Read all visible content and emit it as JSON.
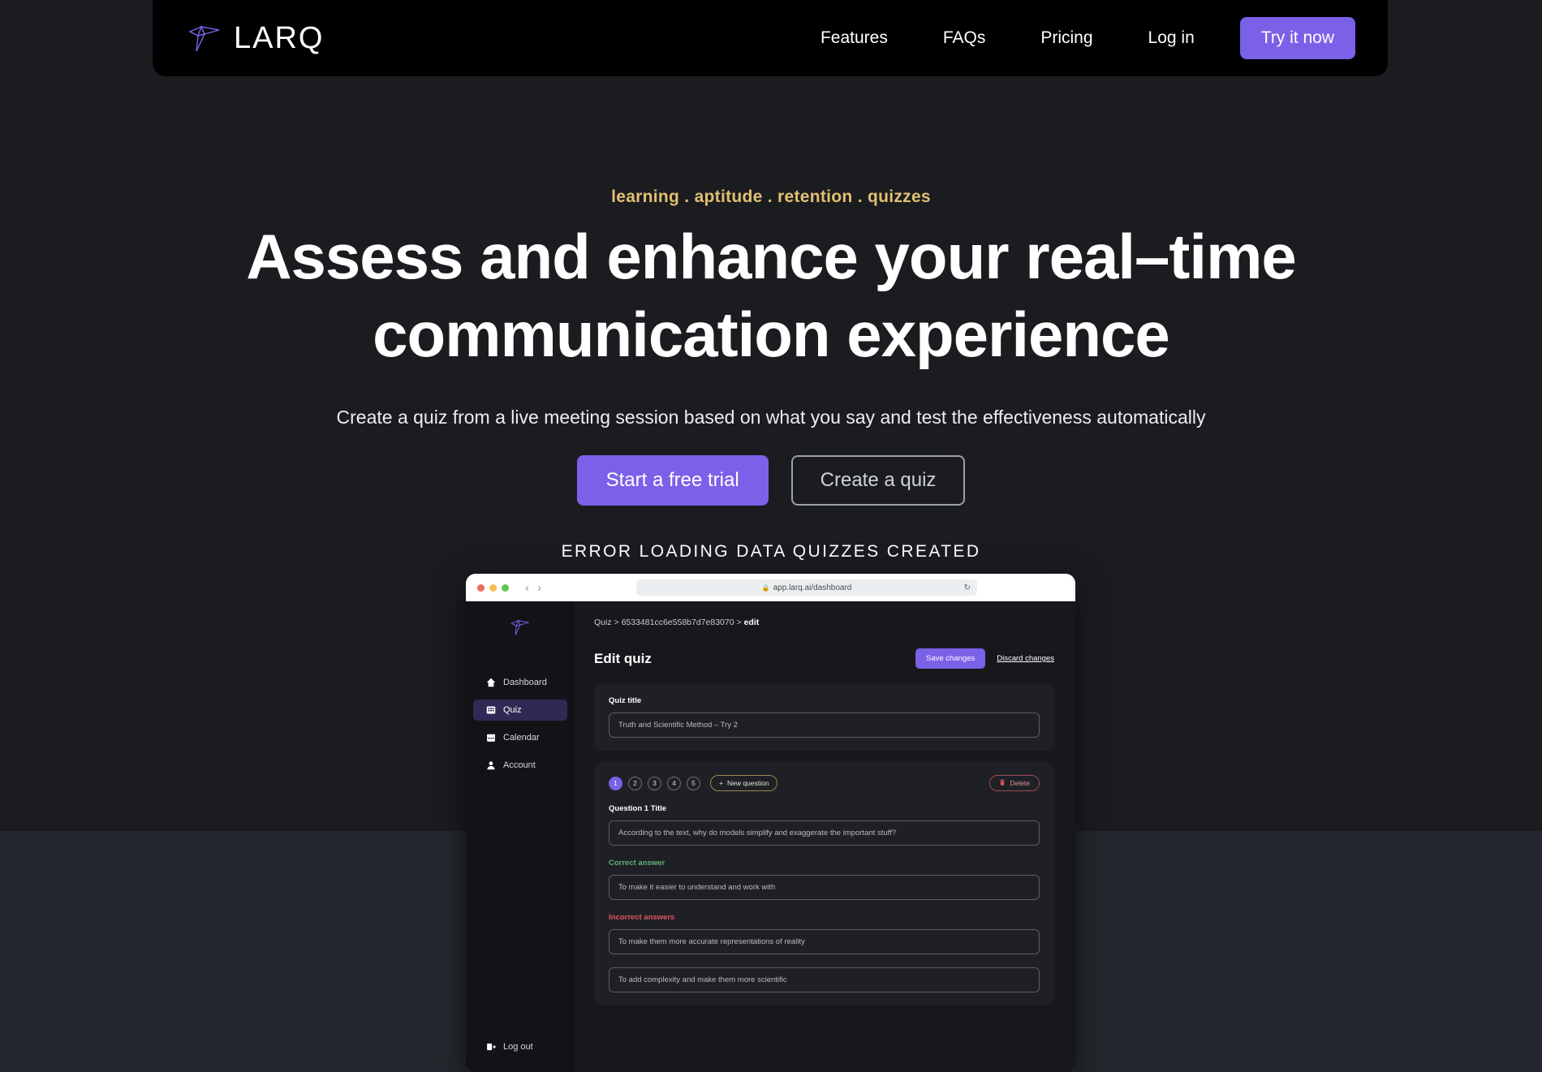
{
  "nav": {
    "brand_name": "LARQ",
    "brand_logo_icon": "hummingbird-logo-icon",
    "links": [
      {
        "label": "Features"
      },
      {
        "label": "FAQs"
      },
      {
        "label": "Pricing"
      },
      {
        "label": "Log in"
      }
    ],
    "cta_label": "Try it now"
  },
  "hero": {
    "eyebrow": "learning . aptitude . retention . quizzes",
    "headline_line1": "Assess and enhance your real–time",
    "headline_line2": "communication experience",
    "subtitle": "Create a quiz from a live meeting session based on what you say and test the effectiveness automatically",
    "primary_cta": "Start a free trial",
    "secondary_cta": "Create a quiz",
    "stat_line": "ERROR LOADING DATA QUIZZES CREATED"
  },
  "mockup": {
    "browser": {
      "url": "app.larq.ai/dashboard",
      "lock_icon": "lock-icon",
      "back_icon": "chevron-left-icon",
      "forward_icon": "chevron-right-icon",
      "reload_icon": "reload-icon"
    },
    "sidebar": {
      "logo_icon": "hummingbird-logo-icon",
      "items": [
        {
          "label": "Dashboard",
          "icon": "home-icon",
          "active": false
        },
        {
          "label": "Quiz",
          "icon": "grid-icon",
          "active": true
        },
        {
          "label": "Calendar",
          "icon": "calendar-icon",
          "active": false
        },
        {
          "label": "Account",
          "icon": "user-icon",
          "active": false
        }
      ],
      "logout": {
        "label": "Log out",
        "icon": "logout-icon"
      }
    },
    "breadcrumb": {
      "root": "Quiz",
      "sep1": ">",
      "id": "6533481cc6e558b7d7e83070",
      "sep2": ">",
      "current": "edit"
    },
    "page_title": "Edit quiz",
    "save_label": "Save changes",
    "discard_label": "Discard changes",
    "quiz_title_label": "Quiz title",
    "quiz_title_value": "Truth and Scientific Method – Try 2",
    "question_pills": [
      "1",
      "2",
      "3",
      "4",
      "5"
    ],
    "active_pill": "1",
    "new_question_label": "New question",
    "new_question_icon": "plus-icon",
    "delete_label": "Delete",
    "delete_icon": "trash-icon",
    "question_title_label": "Question 1 Title",
    "question_title_value": "According to the text, why do models simplify and exaggerate the important stuff?",
    "correct_answer_label": "Correct answer",
    "correct_answer_value": "To make it easier to understand and work with",
    "incorrect_answers_label": "Incorrect answers",
    "incorrect_answer_1": "To make them more accurate representations of reality",
    "incorrect_answer_2": "To add complexity and make them more scientific"
  },
  "colors": {
    "accent_purple": "#7b61e8",
    "eyebrow_gold": "#e3bf72",
    "correct_green": "#5fb37a",
    "incorrect_red": "#e05562",
    "page_bg": "#1a1c20",
    "band_bg": "#24272d"
  }
}
